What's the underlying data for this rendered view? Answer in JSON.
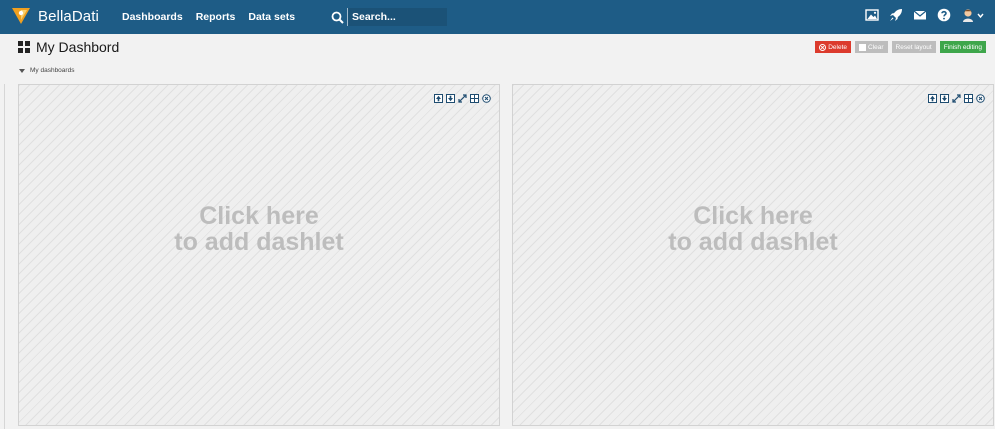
{
  "topbar": {
    "logo_text": "BellaDati",
    "nav": [
      "Dashboards",
      "Reports",
      "Data sets"
    ],
    "search_placeholder": "Search...",
    "icons": [
      "image-icon",
      "rocket-icon",
      "mail-icon",
      "help-icon",
      "user-avatar-icon",
      "chevron-down-icon"
    ],
    "colors": {
      "bar": "#1e5c86",
      "logo": "#f0a020"
    }
  },
  "page": {
    "title": "My Dashbord",
    "section_label": "My dashboards"
  },
  "actions": {
    "delete": "Delete",
    "clear": "Clear",
    "reset": "Reset layout",
    "finish": "Finish editing",
    "colors": {
      "delete": "#dc3b2d",
      "neutral": "#bdbdbd",
      "finish": "#3ea64b"
    }
  },
  "panels": [
    {
      "line1": "Click here",
      "line2": "to add dashlet"
    },
    {
      "line1": "Click here",
      "line2": "to add dashlet"
    }
  ]
}
